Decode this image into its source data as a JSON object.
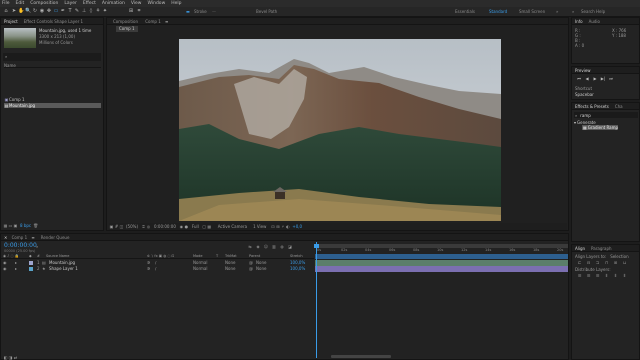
{
  "menu": [
    "File",
    "Edit",
    "Composition",
    "Layer",
    "Effect",
    "Animation",
    "View",
    "Window",
    "Help"
  ],
  "toolbar": {
    "stroke_label": "Stroke",
    "add_label": "Add",
    "bevel_label": "Bevel Path",
    "workspaces": [
      "Essentials",
      "Standard",
      "Small Screen"
    ],
    "search_placeholder": "Search Help"
  },
  "project": {
    "tabs": [
      "Project",
      "Effect Controls Shape Layer 1"
    ],
    "file_name": "Mountain.jpg",
    "file_used": ", used 1 time",
    "file_dims": "3300 x 213 (1,00)",
    "file_colors": "Millions of Colors",
    "search_icon": "search-icon",
    "col_name": "Name",
    "items": [
      {
        "name": "Comp 1",
        "type": "comp"
      },
      {
        "name": "Mountain.jpg",
        "type": "footage",
        "selected": true
      }
    ],
    "footer_bpc": "8 bpc"
  },
  "composition": {
    "tab_label": "Composition",
    "tab_name": "Comp 1",
    "sub_tab": "Comp 1",
    "footer": {
      "zoom": "(50%)",
      "timecode": "0:00:00:00",
      "resolution": "Full",
      "camera": "Active Camera",
      "views": "1 View",
      "exposure": "+0,0"
    }
  },
  "info": {
    "tabs": [
      "Info",
      "Audio"
    ],
    "r": "R :",
    "g": "G :",
    "b": "B :",
    "a": "A : 0",
    "x": "X : 766",
    "y": "Y : 188"
  },
  "preview": {
    "tab": "Preview",
    "shortcut_label": "Shortcut",
    "shortcut_value": "Spacebar"
  },
  "effects": {
    "tab": "Effects & Presets",
    "tab2": "Cha",
    "search_value": "ramp",
    "category": "Generate",
    "item": "Gradient Ramp"
  },
  "align": {
    "tabs": [
      "Align",
      "Paragraph"
    ],
    "align_to_label": "Align Layers to:",
    "align_to_value": "Selection",
    "distribute_label": "Distribute Layers:"
  },
  "timeline": {
    "tabs": [
      "Comp 1",
      "Render Queue"
    ],
    "timecode": "0:00:00:00",
    "fps": "00000 (25.00 fps)",
    "cols": [
      "#",
      "Source Name",
      "Mode",
      "T",
      "TrkMat",
      "Parent",
      "Stretch"
    ],
    "layers": [
      {
        "num": "1",
        "name": "Mountain.jpg",
        "mode": "Normal",
        "trkmat": "None",
        "parent": "None",
        "stretch": "100,0%",
        "color": "#9fa6cf"
      },
      {
        "num": "2",
        "name": "Shape Layer 1",
        "mode": "Normal",
        "trkmat": "None",
        "parent": "None",
        "stretch": "100,0%",
        "color": "#5aa3c9"
      }
    ],
    "ruler": [
      "0s",
      "02s",
      "04s",
      "06s",
      "08s",
      "10s",
      "12s",
      "14s",
      "16s",
      "18s",
      "20s"
    ]
  },
  "colors": {
    "accent_blue": "#3a9ce8",
    "track_purple": "#7b6fb0",
    "track_green": "#5b7e6a"
  }
}
